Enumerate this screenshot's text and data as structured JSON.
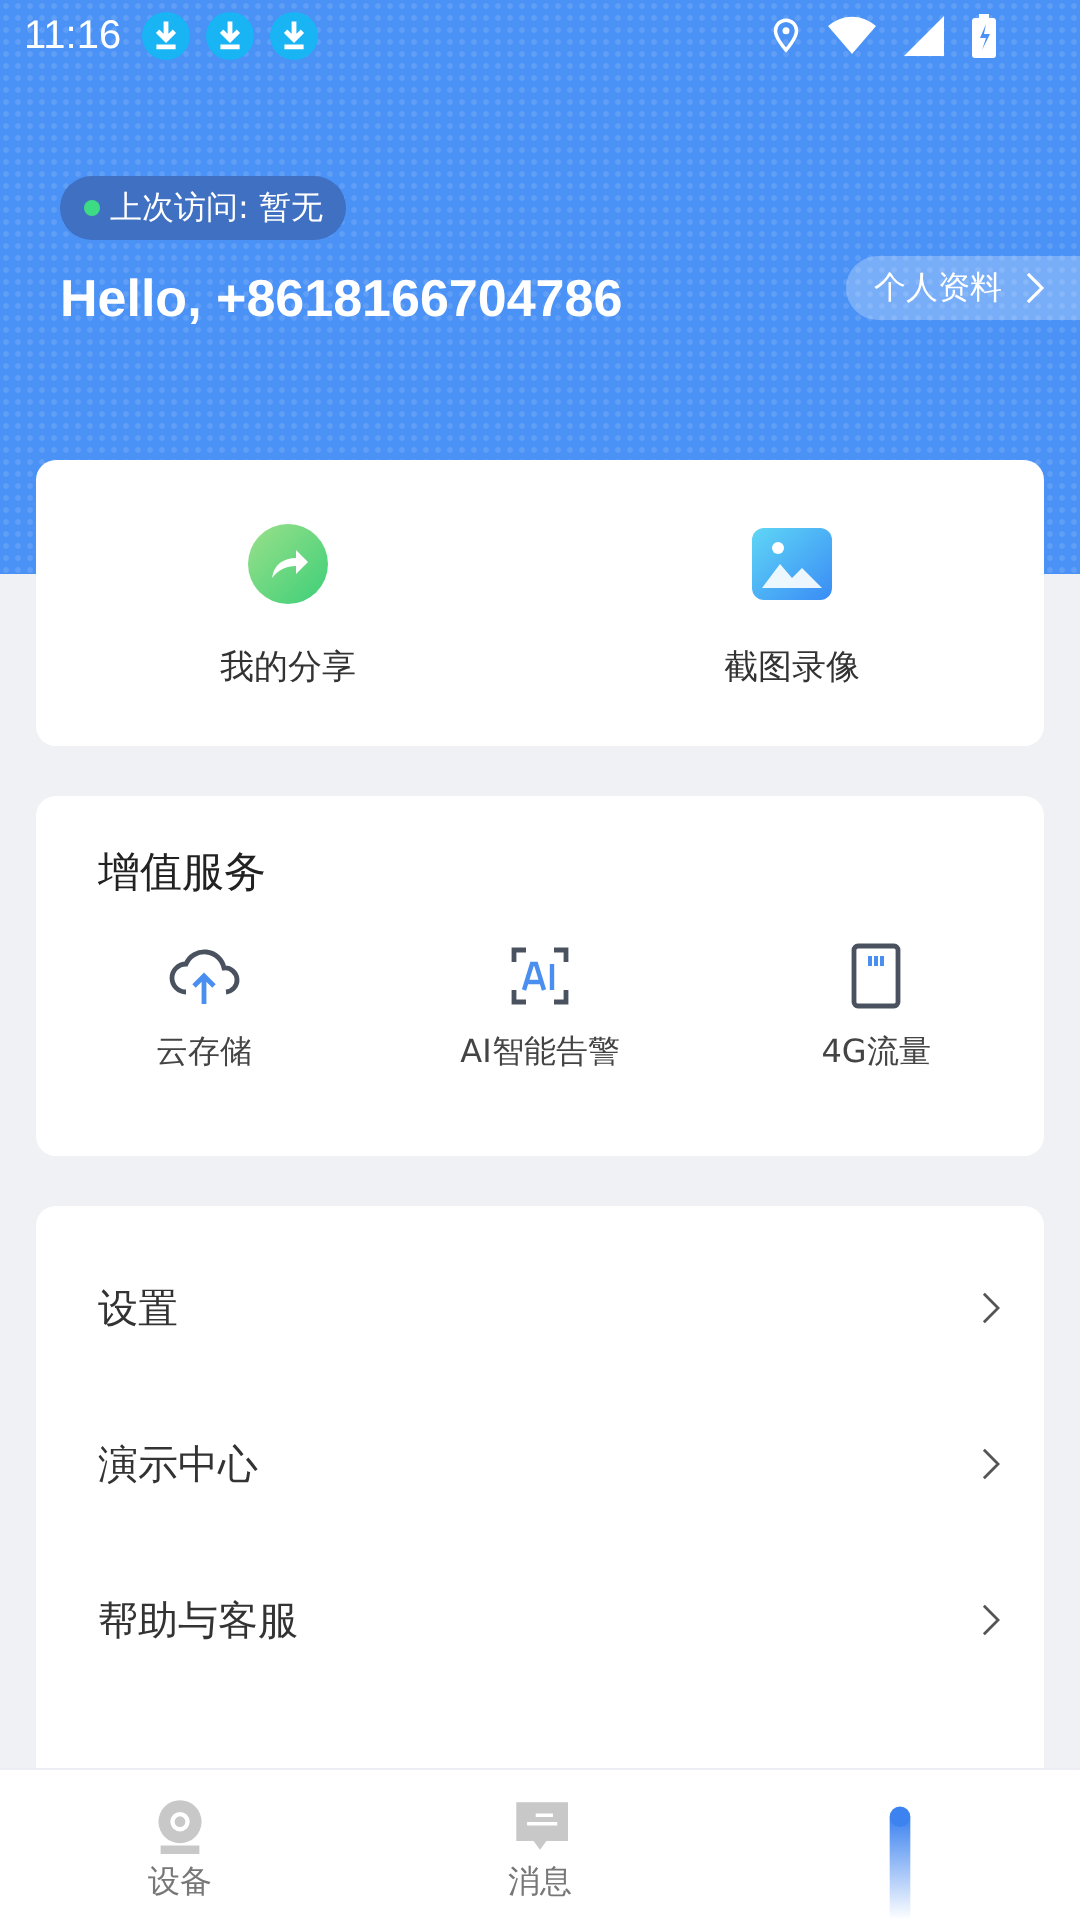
{
  "status_bar": {
    "time": "11:16",
    "notifications": [
      {
        "kind": "download"
      },
      {
        "kind": "download"
      },
      {
        "kind": "download"
      }
    ]
  },
  "header": {
    "last_visit": "上次访问: 暂无",
    "greeting": "Hello, +8618166704786",
    "profile_link": "个人资料"
  },
  "shortcuts": [
    {
      "kind": "share",
      "label": "我的分享"
    },
    {
      "kind": "gallery",
      "label": "截图录像"
    }
  ],
  "services": {
    "title": "增值服务",
    "items": [
      {
        "kind": "cloud",
        "label": "云存储"
      },
      {
        "kind": "ai",
        "label": "AI智能告警"
      },
      {
        "kind": "sim",
        "label": "4G流量"
      }
    ]
  },
  "menu": [
    {
      "label": "设置"
    },
    {
      "label": "演示中心"
    },
    {
      "label": "帮助与客服"
    }
  ],
  "tabs": [
    {
      "kind": "camera",
      "label": "设备",
      "selected": false
    },
    {
      "kind": "message",
      "label": "消息",
      "selected": false
    },
    {
      "selected": true
    }
  ]
}
